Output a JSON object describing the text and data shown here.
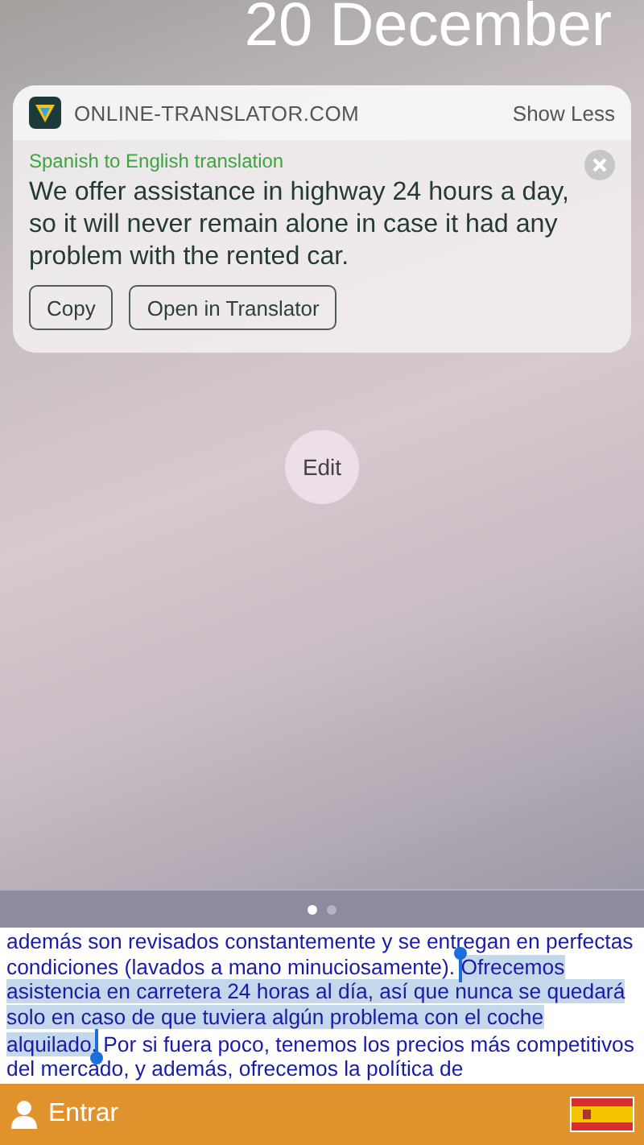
{
  "lock_screen": {
    "date": "20 December"
  },
  "notification": {
    "app_name": "ONLINE-TRANSLATOR.COM",
    "toggle": "Show Less",
    "subtitle": "Spanish to English translation",
    "message": "We offer assistance in highway 24 hours a day, so it will never remain alone in case it had any problem with the rented car.",
    "actions": [
      {
        "label": "Copy"
      },
      {
        "label": "Open in Translator"
      }
    ]
  },
  "edit_button": {
    "label": "Edit"
  },
  "page_dots": [
    {
      "selected": true
    },
    {
      "selected": false
    }
  ],
  "page_text": {
    "before": "además son revisados constantemente y se entregan en perfectas condiciones (lavados a mano minuciosamente). ",
    "selected": "Ofrecemos asistencia en carretera 24 horas al día, así que nunca se quedará solo en caso de que tuviera algún problema con el coche alquilado.",
    "after": " Por si fuera poco, tenemos los precios más competitivos del mercado, y además, ofrecemos la política de"
  },
  "footer": {
    "login": "Entrar"
  }
}
